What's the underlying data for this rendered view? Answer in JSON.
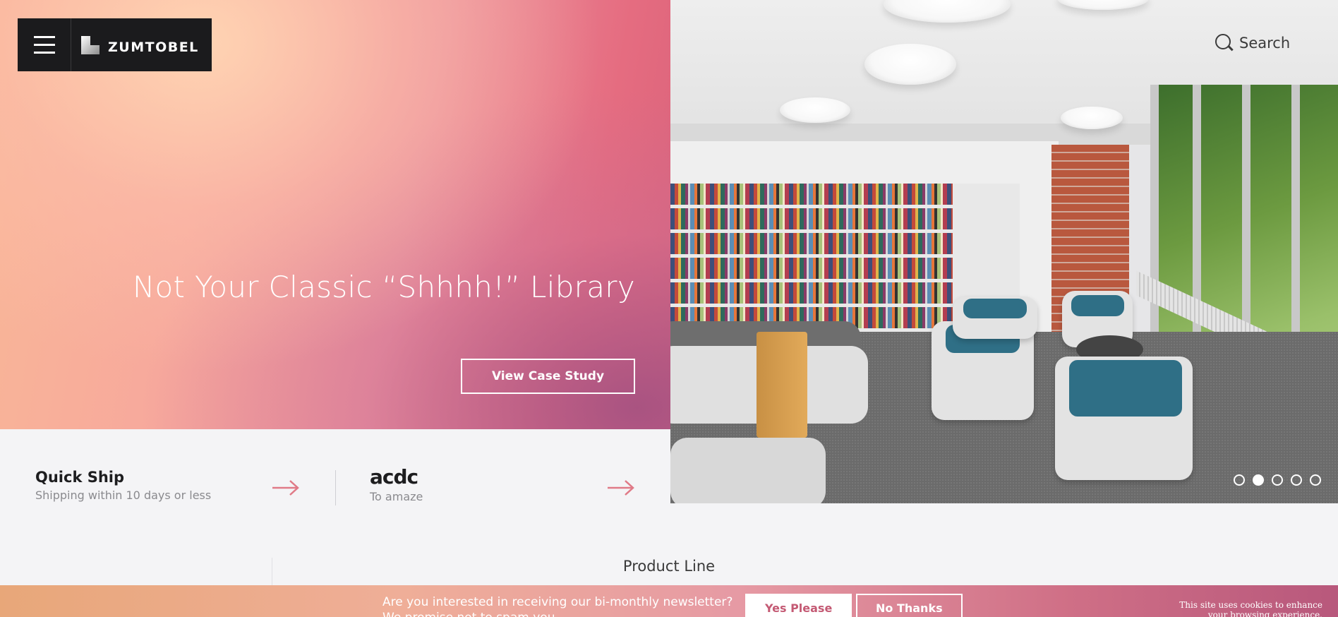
{
  "header": {
    "brand": "ZUMTOBEL",
    "search_label": "Search"
  },
  "hero": {
    "title": "Not Your Classic “Shhhh!” Library",
    "cta_label": "View Case Study",
    "slides_total": 5,
    "active_slide": 2
  },
  "quick_links": [
    {
      "title": "Quick Ship",
      "subtitle": "Shipping within 10 days or less"
    },
    {
      "title": "acdc",
      "subtitle": "To amaze"
    }
  ],
  "section": {
    "product_line": "Product Line"
  },
  "newsletter": {
    "line1": "Are you interested in receiving our bi-monthly newsletter?",
    "line2": "We promise not to spam you.",
    "yes_label": "Yes Please",
    "no_label": "No Thanks"
  },
  "cookie_notice": "This site uses cookies to enhance your browsing experience.",
  "colors": {
    "accent": "#e07a87",
    "dark": "#1b1b1d",
    "text": "#1d1d1f"
  }
}
